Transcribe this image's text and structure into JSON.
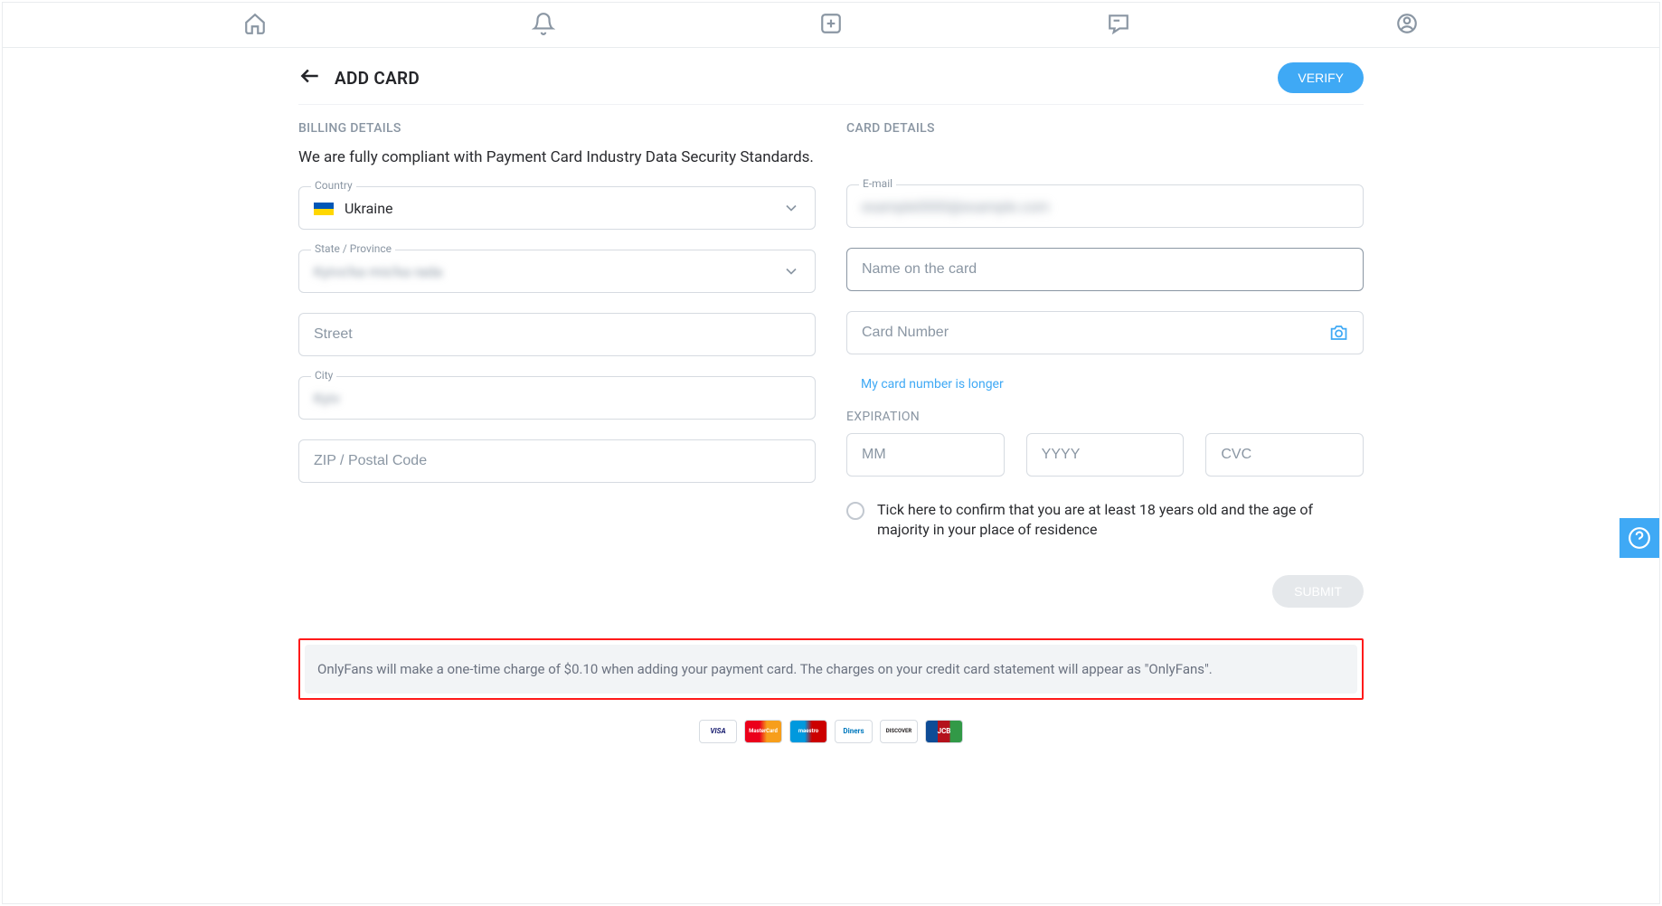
{
  "nav": {
    "icons": [
      "home",
      "bell",
      "plus",
      "message",
      "profile"
    ]
  },
  "header": {
    "title": "ADD CARD",
    "verify_label": "VERIFY"
  },
  "billing": {
    "heading": "BILLING DETAILS",
    "compliance": "We are fully compliant with Payment Card Industry Data Security Standards.",
    "country_label": "Country",
    "country_value": "Ukraine",
    "state_label": "State / Province",
    "state_value": "Kyivs'ka mis'ka rada",
    "street_placeholder": "Street",
    "city_label": "City",
    "city_value": "Kyiv",
    "zip_placeholder": "ZIP / Postal Code"
  },
  "card": {
    "heading": "CARD DETAILS",
    "email_label": "E-mail",
    "email_value": "example0000@example.com",
    "name_placeholder": "Name on the card",
    "number_placeholder": "Card Number",
    "longer_link": "My card number is longer",
    "expiration_label": "EXPIRATION",
    "mm_placeholder": "MM",
    "yyyy_placeholder": "YYYY",
    "cvc_placeholder": "CVC",
    "confirm_text": "Tick here to confirm that you are at least 18 years old and the age of majority in your place of residence"
  },
  "submit_label": "SUBMIT",
  "notice": "OnlyFans will make a one-time charge of $0.10 when adding your payment card. The charges on your credit card statement will appear as \"OnlyFans\".",
  "card_brands": [
    "VISA",
    "MasterCard",
    "maestro",
    "Diners",
    "DISCOVER",
    "JCB"
  ]
}
